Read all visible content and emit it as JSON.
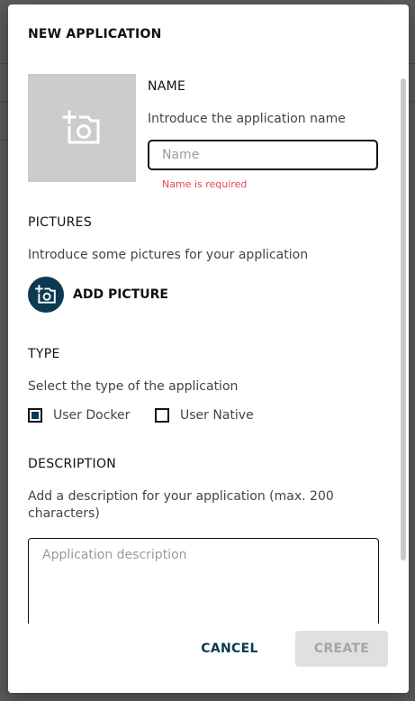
{
  "dialog": {
    "title": "NEW APPLICATION",
    "name_section": {
      "label": "NAME",
      "description": "Introduce the application name",
      "input_placeholder": "Name",
      "input_value": "",
      "error": "Name is required",
      "image_icon": "add-photo-icon"
    },
    "pictures_section": {
      "label": "PICTURES",
      "description": "Introduce some pictures for your application",
      "add_button_label": "ADD PICTURE",
      "add_button_icon": "add-photo-icon"
    },
    "type_section": {
      "label": "TYPE",
      "description": "Select the type of the application",
      "options": [
        {
          "label": "User Docker",
          "checked": true
        },
        {
          "label": "User Native",
          "checked": false
        }
      ]
    },
    "description_section": {
      "label": "DESCRIPTION",
      "description_line1": "Add a description for your application (max. 200",
      "description_line2": "characters)",
      "textarea_placeholder": "Application description",
      "textarea_value": ""
    },
    "footer": {
      "cancel_label": "CANCEL",
      "create_label": "CREATE",
      "create_disabled": true
    }
  },
  "colors": {
    "accent": "#0c3a52",
    "error": "#e0455a",
    "placeholder_bg": "#cccccc",
    "disabled_bg": "#e0e0e0",
    "backdrop": "#5b5b5b"
  }
}
